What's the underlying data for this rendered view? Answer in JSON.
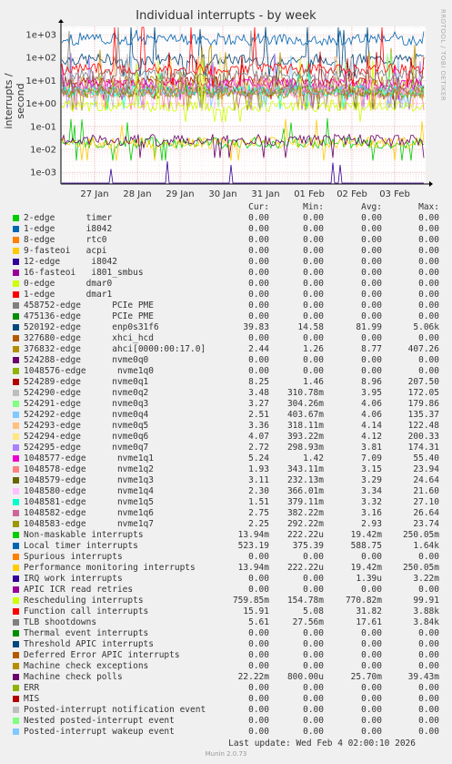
{
  "chart_data": {
    "type": "line",
    "title": "Individual interrupts - by week",
    "ylabel": "interrupts / second",
    "yscale": "log",
    "ylim": [
      0.0005,
      2000
    ],
    "yticks": [
      "1e+03",
      "1e+02",
      "1e+01",
      "1e+00",
      "1e-01",
      "1e-02",
      "1e-03"
    ],
    "xticks": [
      "27 Jan",
      "28 Jan",
      "29 Jan",
      "30 Jan",
      "31 Jan",
      "01 Feb",
      "02 Feb",
      "03 Feb"
    ],
    "grid": true,
    "legend_columns": [
      "Cur:",
      "Min:",
      "Avg:",
      "Max:"
    ],
    "series": [
      {
        "name": "2-edge      timer",
        "color": "#00cc00",
        "cur": "0.00",
        "min": "0.00",
        "avg": "0.00",
        "max": "0.00"
      },
      {
        "name": "1-edge      i8042",
        "color": "#0066b3",
        "cur": "0.00",
        "min": "0.00",
        "avg": "0.00",
        "max": "0.00"
      },
      {
        "name": "8-edge      rtc0",
        "color": "#ff8000",
        "cur": "0.00",
        "min": "0.00",
        "avg": "0.00",
        "max": "0.00"
      },
      {
        "name": "9-fasteoi   acpi",
        "color": "#ffcc00",
        "cur": "0.00",
        "min": "0.00",
        "avg": "0.00",
        "max": "0.00"
      },
      {
        "name": "12-edge      i8042",
        "color": "#330099",
        "cur": "0.00",
        "min": "0.00",
        "avg": "0.00",
        "max": "0.00"
      },
      {
        "name": "16-fasteoi   i801_smbus",
        "color": "#990099",
        "cur": "0.00",
        "min": "0.00",
        "avg": "0.00",
        "max": "0.00"
      },
      {
        "name": "0-edge      dmar0",
        "color": "#ccff00",
        "cur": "0.00",
        "min": "0.00",
        "avg": "0.00",
        "max": "0.00"
      },
      {
        "name": "1-edge      dmar1",
        "color": "#ff0000",
        "cur": "0.00",
        "min": "0.00",
        "avg": "0.00",
        "max": "0.00"
      },
      {
        "name": "458752-edge      PCIe PME",
        "color": "#808080",
        "cur": "0.00",
        "min": "0.00",
        "avg": "0.00",
        "max": "0.00"
      },
      {
        "name": "475136-edge      PCIe PME",
        "color": "#008f00",
        "cur": "0.00",
        "min": "0.00",
        "avg": "0.00",
        "max": "0.00"
      },
      {
        "name": "520192-edge      enp0s31f6",
        "color": "#00487d",
        "cur": "39.83",
        "min": "14.58",
        "avg": "81.99",
        "max": "5.06k"
      },
      {
        "name": "327680-edge      xhci_hcd",
        "color": "#b35a00",
        "cur": "0.00",
        "min": "0.00",
        "avg": "0.00",
        "max": "0.00"
      },
      {
        "name": "376832-edge      ahci[0000:00:17.0]",
        "color": "#b38f00",
        "cur": "2.44",
        "min": "1.26",
        "avg": "8.77",
        "max": "407.26"
      },
      {
        "name": "524288-edge      nvme0q0",
        "color": "#6b006b",
        "cur": "0.00",
        "min": "0.00",
        "avg": "0.00",
        "max": "0.00"
      },
      {
        "name": "1048576-edge      nvme1q0",
        "color": "#8fb300",
        "cur": "0.00",
        "min": "0.00",
        "avg": "0.00",
        "max": "0.00"
      },
      {
        "name": "524289-edge      nvme0q1",
        "color": "#b30000",
        "cur": "8.25",
        "min": "1.46",
        "avg": "8.96",
        "max": "207.50"
      },
      {
        "name": "524290-edge      nvme0q2",
        "color": "#bebebe",
        "cur": "3.48",
        "min": "310.78m",
        "avg": "3.95",
        "max": "172.05"
      },
      {
        "name": "524291-edge      nvme0q3",
        "color": "#80ff80",
        "cur": "3.27",
        "min": "304.26m",
        "avg": "4.06",
        "max": "179.86"
      },
      {
        "name": "524292-edge      nvme0q4",
        "color": "#80c9ff",
        "cur": "2.51",
        "min": "403.67m",
        "avg": "4.06",
        "max": "135.37"
      },
      {
        "name": "524293-edge      nvme0q5",
        "color": "#ffc080",
        "cur": "3.36",
        "min": "318.11m",
        "avg": "4.14",
        "max": "122.48"
      },
      {
        "name": "524294-edge      nvme0q6",
        "color": "#ffe680",
        "cur": "4.07",
        "min": "393.22m",
        "avg": "4.12",
        "max": "200.33"
      },
      {
        "name": "524295-edge      nvme0q7",
        "color": "#aa80ff",
        "cur": "2.72",
        "min": "298.93m",
        "avg": "3.81",
        "max": "174.31"
      },
      {
        "name": "1048577-edge      nvme1q1",
        "color": "#ee00cc",
        "cur": "5.24",
        "min": "1.42",
        "avg": "7.09",
        "max": "55.40"
      },
      {
        "name": "1048578-edge      nvme1q2",
        "color": "#ff8080",
        "cur": "1.93",
        "min": "343.11m",
        "avg": "3.15",
        "max": "23.94"
      },
      {
        "name": "1048579-edge      nvme1q3",
        "color": "#666600",
        "cur": "3.11",
        "min": "232.13m",
        "avg": "3.29",
        "max": "24.64"
      },
      {
        "name": "1048580-edge      nvme1q4",
        "color": "#ffbfff",
        "cur": "2.30",
        "min": "366.01m",
        "avg": "3.34",
        "max": "21.60"
      },
      {
        "name": "1048581-edge      nvme1q5",
        "color": "#00ffcc",
        "cur": "1.51",
        "min": "379.11m",
        "avg": "3.32",
        "max": "27.10"
      },
      {
        "name": "1048582-edge      nvme1q6",
        "color": "#cc6699",
        "cur": "2.75",
        "min": "382.22m",
        "avg": "3.16",
        "max": "26.64"
      },
      {
        "name": "1048583-edge      nvme1q7",
        "color": "#999900",
        "cur": "2.25",
        "min": "292.22m",
        "avg": "2.93",
        "max": "23.74"
      },
      {
        "name": "Non-maskable interrupts",
        "color": "#00cc00",
        "cur": "13.94m",
        "min": "222.22u",
        "avg": "19.42m",
        "max": "250.05m"
      },
      {
        "name": "Local timer interrupts",
        "color": "#0066b3",
        "cur": "523.19",
        "min": "375.39",
        "avg": "588.75",
        "max": "1.64k"
      },
      {
        "name": "Spurious interrupts",
        "color": "#ff8000",
        "cur": "0.00",
        "min": "0.00",
        "avg": "0.00",
        "max": "0.00"
      },
      {
        "name": "Performance monitoring interrupts",
        "color": "#ffcc00",
        "cur": "13.94m",
        "min": "222.22u",
        "avg": "19.42m",
        "max": "250.05m"
      },
      {
        "name": "IRQ work interrupts",
        "color": "#330099",
        "cur": "0.00",
        "min": "0.00",
        "avg": "1.39u",
        "max": "3.22m"
      },
      {
        "name": "APIC ICR read retries",
        "color": "#990099",
        "cur": "0.00",
        "min": "0.00",
        "avg": "0.00",
        "max": "0.00"
      },
      {
        "name": "Rescheduling interrupts",
        "color": "#ccff00",
        "cur": "759.85m",
        "min": "154.78m",
        "avg": "770.82m",
        "max": "99.91"
      },
      {
        "name": "Function call interrupts",
        "color": "#ff0000",
        "cur": "15.91",
        "min": "5.08",
        "avg": "31.82",
        "max": "3.88k"
      },
      {
        "name": "TLB shootdowns",
        "color": "#808080",
        "cur": "5.61",
        "min": "27.56m",
        "avg": "17.61",
        "max": "3.84k"
      },
      {
        "name": "Thermal event interrupts",
        "color": "#008f00",
        "cur": "0.00",
        "min": "0.00",
        "avg": "0.00",
        "max": "0.00"
      },
      {
        "name": "Threshold APIC interrupts",
        "color": "#00487d",
        "cur": "0.00",
        "min": "0.00",
        "avg": "0.00",
        "max": "0.00"
      },
      {
        "name": "Deferred Error APIC interrupts",
        "color": "#b35a00",
        "cur": "0.00",
        "min": "0.00",
        "avg": "0.00",
        "max": "0.00"
      },
      {
        "name": "Machine check exceptions",
        "color": "#b38f00",
        "cur": "0.00",
        "min": "0.00",
        "avg": "0.00",
        "max": "0.00"
      },
      {
        "name": "Machine check polls",
        "color": "#6b006b",
        "cur": "22.22m",
        "min": "800.00u",
        "avg": "25.70m",
        "max": "39.43m"
      },
      {
        "name": "ERR",
        "color": "#8fb300",
        "cur": "0.00",
        "min": "0.00",
        "avg": "0.00",
        "max": "0.00"
      },
      {
        "name": "MIS",
        "color": "#b30000",
        "cur": "0.00",
        "min": "0.00",
        "avg": "0.00",
        "max": "0.00"
      },
      {
        "name": "Posted-interrupt notification event",
        "color": "#bebebe",
        "cur": "0.00",
        "min": "0.00",
        "avg": "0.00",
        "max": "0.00"
      },
      {
        "name": "Nested posted-interrupt event",
        "color": "#80ff80",
        "cur": "0.00",
        "min": "0.00",
        "avg": "0.00",
        "max": "0.00"
      },
      {
        "name": "Posted-interrupt wakeup event",
        "color": "#80c9ff",
        "cur": "0.00",
        "min": "0.00",
        "avg": "0.00",
        "max": "0.00"
      }
    ]
  },
  "watermark": "RRDTOOL / TOBI OETIKER",
  "last_update": "Last update: Wed Feb  4 02:00:10 2026",
  "footer": "Munin 2.0.73"
}
